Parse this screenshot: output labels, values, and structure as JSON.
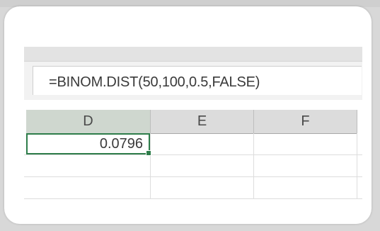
{
  "formula_bar": {
    "formula": "=BINOM.DIST(50,100,0.5,FALSE)"
  },
  "columns": [
    {
      "label": "D",
      "selected": true
    },
    {
      "label": "E",
      "selected": false
    },
    {
      "label": "F",
      "selected": false
    }
  ],
  "cells": {
    "d1": "0.0796"
  },
  "colors": {
    "selection_green": "#2e7d4a"
  }
}
